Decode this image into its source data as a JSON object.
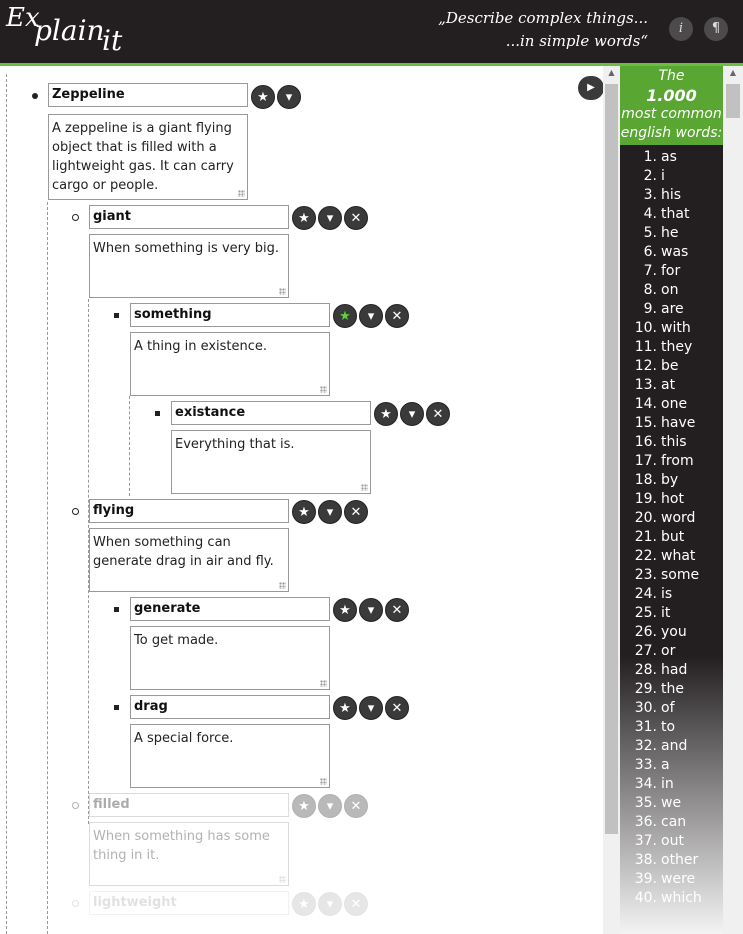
{
  "header": {
    "logo": {
      "ex": "Ex",
      "plain": "plain",
      "it": "it"
    },
    "slogan_line1": "„Describe complex things...",
    "slogan_line2": "...in simple words“",
    "info_icon": "i",
    "paragraph_icon": "¶"
  },
  "controls": {
    "star": "★",
    "down": "▾",
    "close": "✕",
    "collapse": "▶"
  },
  "tree": [
    {
      "term": "Zeppeline",
      "desc": "A zeppeline is a giant flying object that is filled with a lightweight gas. It can carry cargo or people."
    },
    {
      "term": "giant",
      "desc": "When something is very big."
    },
    {
      "term": "something",
      "desc": "A thing in existence."
    },
    {
      "term": "existance",
      "desc": "Everything that is."
    },
    {
      "term": "flying",
      "desc": "When something can generate drag in air and fly."
    },
    {
      "term": "generate",
      "desc": "To get made."
    },
    {
      "term": "drag",
      "desc": "A special force."
    },
    {
      "term": "filled",
      "desc": "When something has some thing in it."
    },
    {
      "term": "lightweight",
      "desc": ""
    }
  ],
  "sidebar": {
    "line1": "The",
    "line2": "1.000",
    "line3": "most common",
    "line4": "english words:",
    "words": [
      {
        "n": "1.",
        "w": "as"
      },
      {
        "n": "2.",
        "w": "i"
      },
      {
        "n": "3.",
        "w": "his"
      },
      {
        "n": "4.",
        "w": "that"
      },
      {
        "n": "5.",
        "w": "he"
      },
      {
        "n": "6.",
        "w": "was"
      },
      {
        "n": "7.",
        "w": "for"
      },
      {
        "n": "8.",
        "w": "on"
      },
      {
        "n": "9.",
        "w": "are"
      },
      {
        "n": "10.",
        "w": "with"
      },
      {
        "n": "11.",
        "w": "they"
      },
      {
        "n": "12.",
        "w": "be"
      },
      {
        "n": "13.",
        "w": "at"
      },
      {
        "n": "14.",
        "w": "one"
      },
      {
        "n": "15.",
        "w": "have"
      },
      {
        "n": "16.",
        "w": "this"
      },
      {
        "n": "17.",
        "w": "from"
      },
      {
        "n": "18.",
        "w": "by"
      },
      {
        "n": "19.",
        "w": "hot"
      },
      {
        "n": "20.",
        "w": "word"
      },
      {
        "n": "21.",
        "w": "but"
      },
      {
        "n": "22.",
        "w": "what"
      },
      {
        "n": "23.",
        "w": "some"
      },
      {
        "n": "24.",
        "w": "is"
      },
      {
        "n": "25.",
        "w": "it"
      },
      {
        "n": "26.",
        "w": "you"
      },
      {
        "n": "27.",
        "w": "or"
      },
      {
        "n": "28.",
        "w": "had"
      },
      {
        "n": "29.",
        "w": "the"
      },
      {
        "n": "30.",
        "w": "of"
      },
      {
        "n": "31.",
        "w": "to"
      },
      {
        "n": "32.",
        "w": "and"
      },
      {
        "n": "33.",
        "w": "a"
      },
      {
        "n": "34.",
        "w": "in"
      },
      {
        "n": "35.",
        "w": "we"
      },
      {
        "n": "36.",
        "w": "can"
      },
      {
        "n": "37.",
        "w": "out"
      },
      {
        "n": "38.",
        "w": "other"
      },
      {
        "n": "39.",
        "w": "were"
      },
      {
        "n": "40.",
        "w": "which"
      }
    ]
  }
}
